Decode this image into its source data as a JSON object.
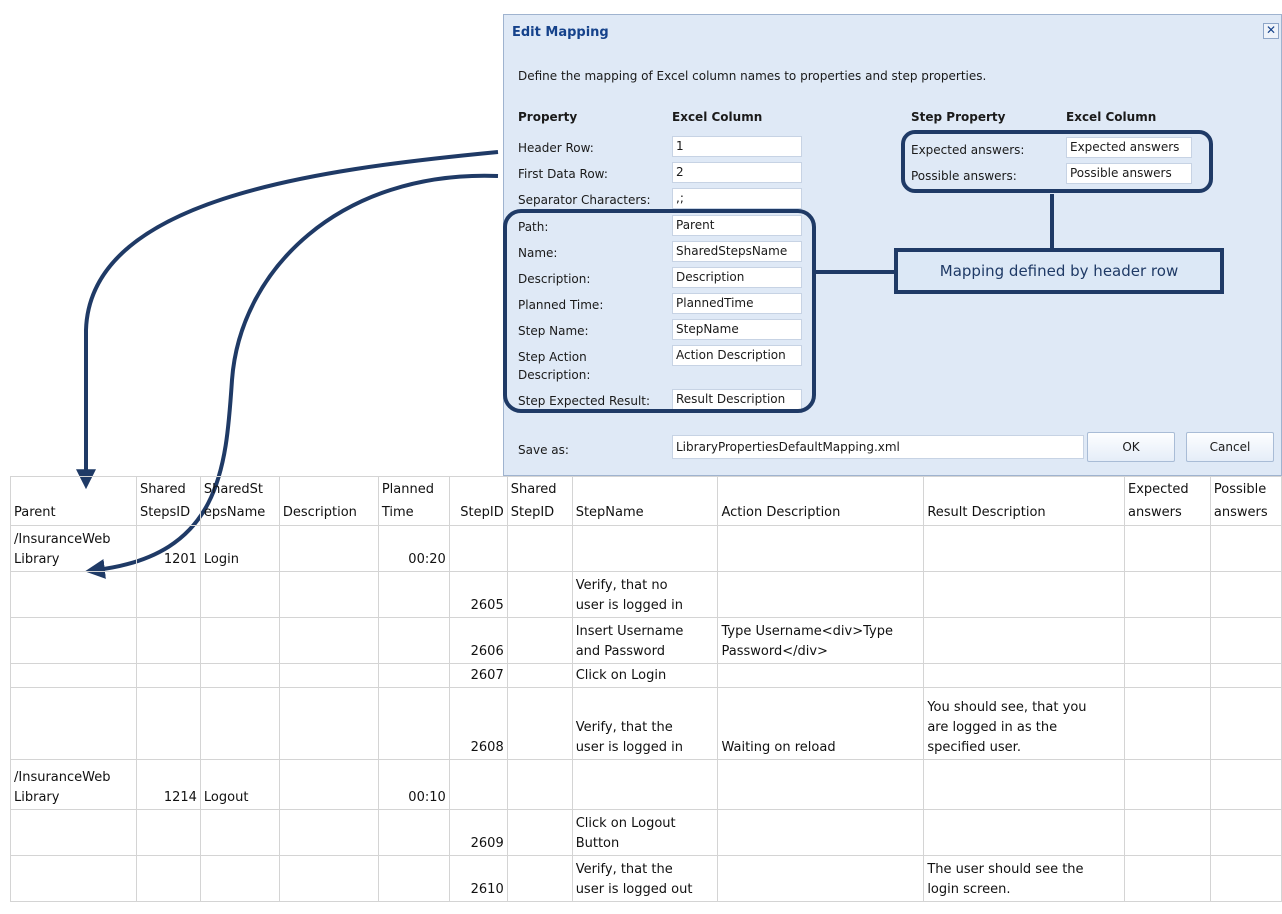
{
  "dialog": {
    "title": "Edit Mapping",
    "description": "Define the mapping of Excel column names to properties and step properties.",
    "col_property": "Property",
    "col_excel_column": "Excel Column",
    "col_step_property": "Step Property",
    "col_step_excel_column": "Excel Column",
    "rows": [
      {
        "label": "Header Row:",
        "value": "1"
      },
      {
        "label": "First Data Row:",
        "value": "2"
      },
      {
        "label": "Separator Characters:",
        "value": ",;"
      },
      {
        "label": "Path:",
        "value": "Parent"
      },
      {
        "label": "Name:",
        "value": "SharedStepsName"
      },
      {
        "label": "Description:",
        "value": "Description"
      },
      {
        "label": "Planned Time:",
        "value": "PlannedTime"
      },
      {
        "label": "Step Name:",
        "value": "StepName"
      },
      {
        "label": "Step Action Description:",
        "value": "Action Description"
      },
      {
        "label": "Step Expected Result:",
        "value": "Result Description"
      }
    ],
    "step_rows": [
      {
        "label": "Expected answers:",
        "value": "Expected answers"
      },
      {
        "label": "Possible answers:",
        "value": "Possible answers"
      }
    ],
    "save_as_label": "Save as:",
    "save_as_value": "LibraryPropertiesDefaultMapping.xml",
    "ok_label": "OK",
    "cancel_label": "Cancel"
  },
  "annotation": {
    "callout": "Mapping defined by header row",
    "colors": {
      "outline": "#1f3a66",
      "callout_bg": "#dce8f6"
    }
  },
  "sheet": {
    "headers": [
      "Parent",
      "Shared\nStepsID",
      "SharedSt\nepsName",
      "Description",
      "Planned\nTime",
      "StepID",
      "Shared\nStepID",
      "StepName",
      "Action Description",
      "Result Description",
      "Expected\nanswers",
      "Possible\nanswers"
    ],
    "rows": [
      [
        "/InsuranceWeb\nLibrary",
        "1201",
        "Login",
        "",
        "00:20",
        "",
        "",
        "",
        "",
        "",
        "",
        ""
      ],
      [
        "",
        "",
        "",
        "",
        "",
        "2605",
        "",
        "Verify, that no\nuser is logged in",
        "",
        "",
        "",
        ""
      ],
      [
        "",
        "",
        "",
        "",
        "",
        "2606",
        "",
        "Insert Username\nand Password",
        "Type Username<div>Type\nPassword</div>",
        "",
        "",
        ""
      ],
      [
        "",
        "",
        "",
        "",
        "",
        "2607",
        "",
        "Click on Login",
        "",
        "",
        "",
        ""
      ],
      [
        "",
        "",
        "",
        "",
        "",
        "2608",
        "",
        "Verify, that the\nuser is logged in",
        "Waiting on reload",
        "You should see, that you\nare logged in as the\nspecified user.",
        "",
        ""
      ],
      [
        "/InsuranceWeb\nLibrary",
        "1214",
        "Logout",
        "",
        "00:10",
        "",
        "",
        "",
        "",
        "",
        "",
        ""
      ],
      [
        "",
        "",
        "",
        "",
        "",
        "2609",
        "",
        "Click on Logout\nButton",
        "",
        "",
        "",
        ""
      ],
      [
        "",
        "",
        "",
        "",
        "",
        "2610",
        "",
        "Verify, that the\nuser is logged out",
        "",
        "The user should see the\nlogin screen.",
        "",
        ""
      ]
    ]
  }
}
